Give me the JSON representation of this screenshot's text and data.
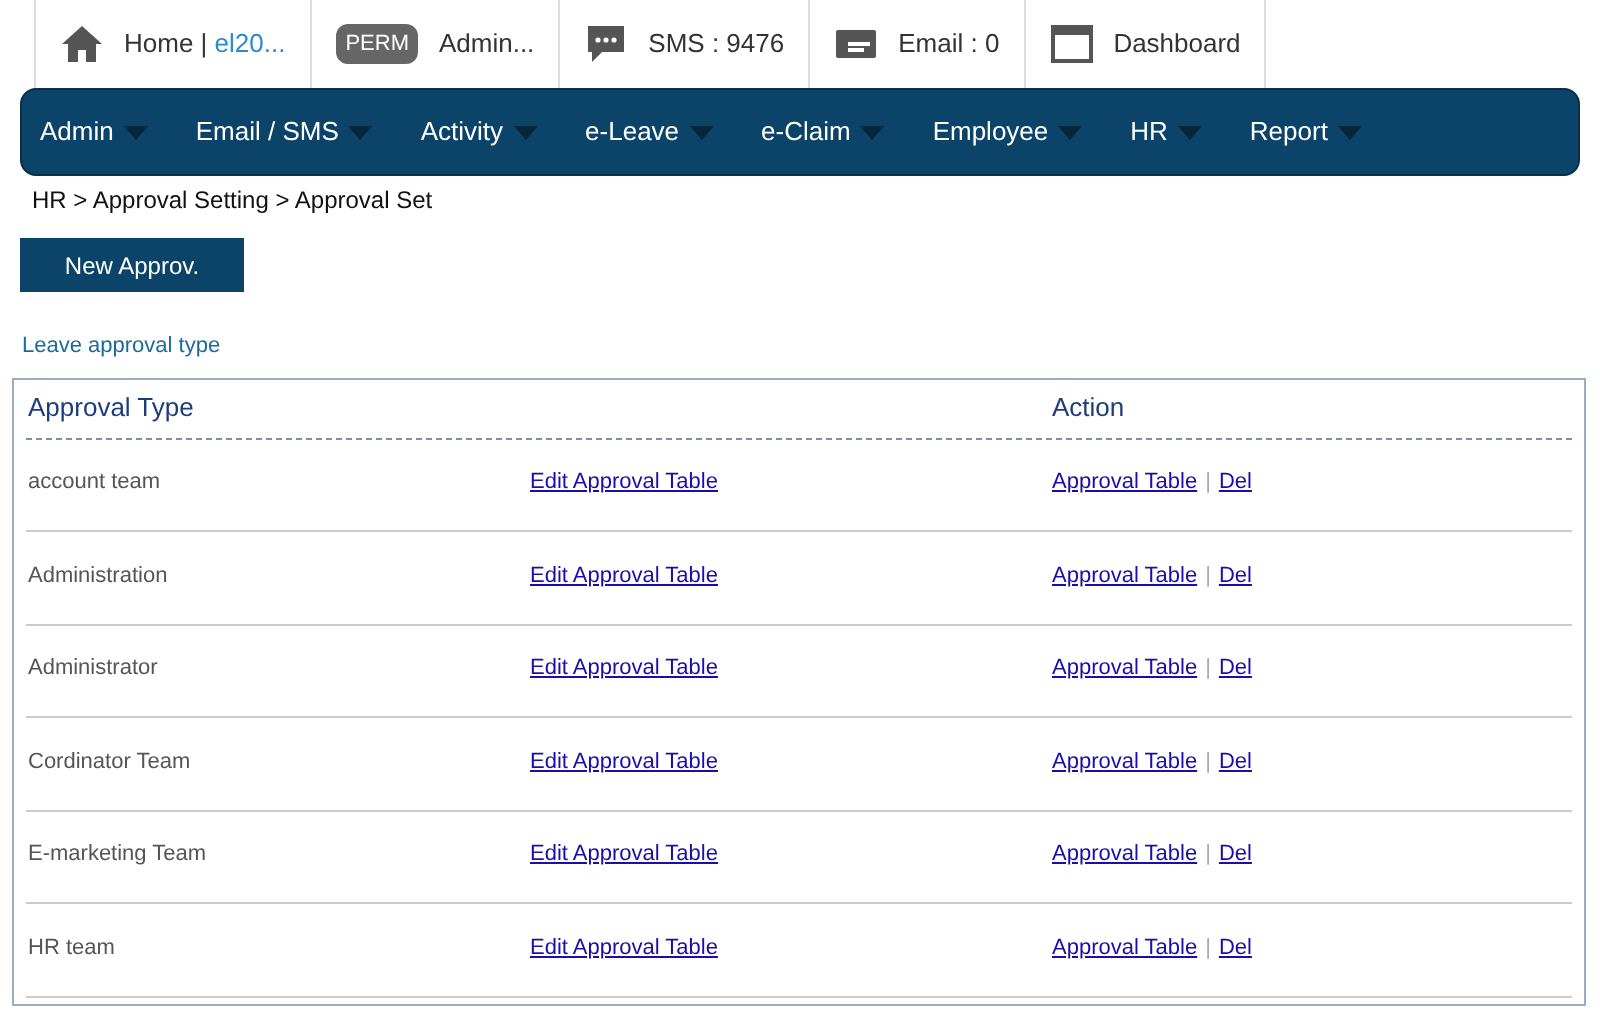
{
  "top_bar": [
    {
      "kind": "home",
      "label": "Home | ",
      "link": "el20..."
    },
    {
      "kind": "perm",
      "badge": "PERM",
      "label": "Admin..."
    },
    {
      "kind": "sms",
      "label": "SMS : 9476"
    },
    {
      "kind": "email",
      "label": "Email : 0"
    },
    {
      "kind": "dashboard",
      "label": "Dashboard"
    }
  ],
  "nav": [
    "Admin",
    "Email / SMS",
    "Activity",
    "e-Leave",
    "e-Claim",
    "Employee",
    "HR",
    "Report"
  ],
  "breadcrumb": "HR > Approval Setting > Approval Set",
  "new_button": "New Approv.",
  "section_link": "Leave approval type",
  "table": {
    "columns": [
      "Approval Type",
      "Action"
    ],
    "rows": [
      {
        "type": "account team",
        "edit": "Edit Approval Table",
        "approval": "Approval Table",
        "separator": "|",
        "delete": "Del"
      },
      {
        "type": "Administration",
        "edit": "Edit Approval Table",
        "approval": "Approval Table",
        "separator": "|",
        "delete": "Del"
      },
      {
        "type": "Administrator",
        "edit": "Edit Approval Table",
        "approval": "Approval Table",
        "separator": "|",
        "delete": "Del"
      },
      {
        "type": "Cordinator Team",
        "edit": "Edit Approval Table",
        "approval": "Approval Table",
        "separator": "|",
        "delete": "Del"
      },
      {
        "type": "E-marketing Team",
        "edit": "Edit Approval Table",
        "approval": "Approval Table",
        "separator": "|",
        "delete": "Del"
      },
      {
        "type": "HR team",
        "edit": "Edit Approval Table",
        "approval": "Approval Table",
        "separator": "|",
        "delete": "Del"
      }
    ]
  }
}
